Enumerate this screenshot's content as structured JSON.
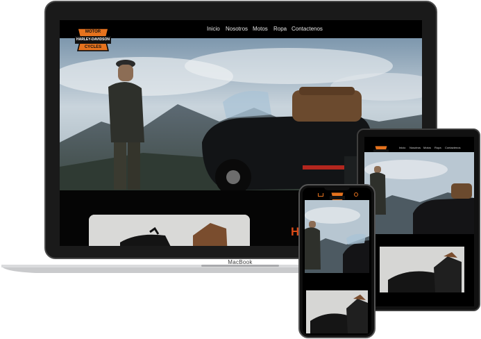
{
  "brand": {
    "logo_top": "MOTOR",
    "logo_mid": "HARLEY-DAVIDSON",
    "logo_bot": "CYCLES"
  },
  "nav": {
    "items": [
      "Inicio",
      "Nosotros",
      "Motos",
      "Ropa",
      "Contactenos"
    ]
  },
  "hero": {
    "accent_text": "H"
  },
  "device": {
    "laptop_label": "MacBook"
  },
  "tablet_nav": {
    "items": [
      "Inicio",
      "Nosotros",
      "Motos",
      "Ropa",
      "Contactenos"
    ]
  },
  "colors": {
    "accent": "#d94a17",
    "background": "#000000",
    "nav_text": "#e6e6e6"
  }
}
